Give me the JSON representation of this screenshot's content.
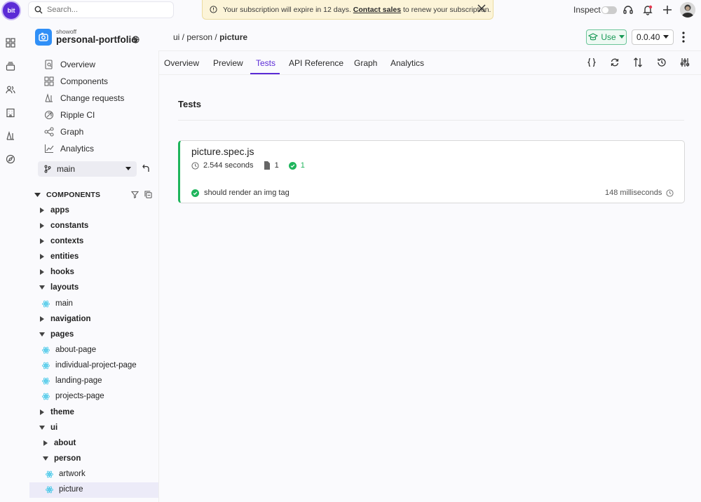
{
  "topbar": {
    "logo_text": "bit",
    "search_placeholder": "Search...",
    "banner_text": "Your subscription will expire in 12 days.",
    "banner_link": "Contact sales",
    "banner_suffix": "to renew your subscription.",
    "inspect_label": "Inspect"
  },
  "project": {
    "org": "showoff",
    "name": "personal-portfolio"
  },
  "breadcrumb": {
    "part1": "ui",
    "part2": "person",
    "current": "picture"
  },
  "actions": {
    "use_label": "Use",
    "version": "0.0.40"
  },
  "tabs": [
    "Overview",
    "Preview",
    "Tests",
    "API Reference",
    "Graph",
    "Analytics"
  ],
  "active_tab": "Tests",
  "sidebar": {
    "nav": [
      "Overview",
      "Components",
      "Change requests",
      "Ripple CI",
      "Graph",
      "Analytics"
    ],
    "branch": "main",
    "components_header": "COMPONENTS",
    "tree": {
      "apps": "apps",
      "constants": "constants",
      "contexts": "contexts",
      "entities": "entities",
      "hooks": "hooks",
      "layouts": "layouts",
      "main": "main",
      "navigation": "navigation",
      "pages": "pages",
      "about_page": "about-page",
      "individual_project_page": "individual-project-page",
      "landing_page": "landing-page",
      "projects_page": "projects-page",
      "theme": "theme",
      "ui": "ui",
      "about": "about",
      "person": "person",
      "artwork": "artwork",
      "picture": "picture"
    }
  },
  "main": {
    "title": "Tests",
    "spec": {
      "name": "picture.spec.js",
      "duration": "2.544 seconds",
      "files": "1",
      "passed": "1",
      "cases": [
        {
          "name": "should render an img tag",
          "duration": "148 milliseconds",
          "status": "passed"
        }
      ]
    }
  },
  "colors": {
    "accent": "#5b2bd6",
    "pass": "#1fb55c",
    "banner_bg": "#fcf4d8",
    "use_green": "#1a9a57"
  }
}
